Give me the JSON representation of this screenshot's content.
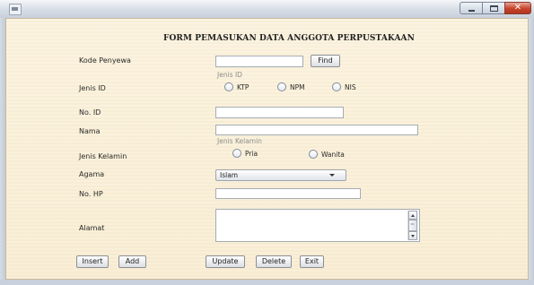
{
  "form": {
    "title": "FORM PEMASUKAN DATA ANGGOTA PERPUSTAKAAN",
    "kode_penyewa": {
      "label": "Kode Penyewa",
      "value": ""
    },
    "find_label": "Find",
    "jenis_id": {
      "label": "Jenis ID",
      "caption": "Jenis ID",
      "options": [
        "KTP",
        "NPM",
        "NIS"
      ]
    },
    "no_id": {
      "label": "No. ID",
      "value": ""
    },
    "nama": {
      "label": "Nama",
      "value": ""
    },
    "jenis_kelamin": {
      "label": "Jenis Kelamin",
      "caption": "Jenis Kelamin",
      "options": [
        "Pria",
        "Wanita"
      ]
    },
    "agama": {
      "label": "Agama",
      "selected": "Islam"
    },
    "no_hp": {
      "label": "No. HP",
      "value": ""
    },
    "alamat": {
      "label": "Alamat",
      "value": ""
    },
    "buttons": {
      "insert": "Insert",
      "add": "Add",
      "update": "Update",
      "delete": "Delete",
      "exit": "Exit"
    }
  },
  "icons": {
    "app": "java-app-icon",
    "minimize": "minimize-icon",
    "maximize": "maximize-icon",
    "close": "close-icon",
    "dropdown": "chevron-down-icon",
    "scroll_up": "arrow-up-icon",
    "scroll_down": "arrow-down-icon"
  },
  "colors": {
    "panel_background": "#fbf0d8",
    "close_button": "#c7432b",
    "field_border": "#a5acb5"
  }
}
